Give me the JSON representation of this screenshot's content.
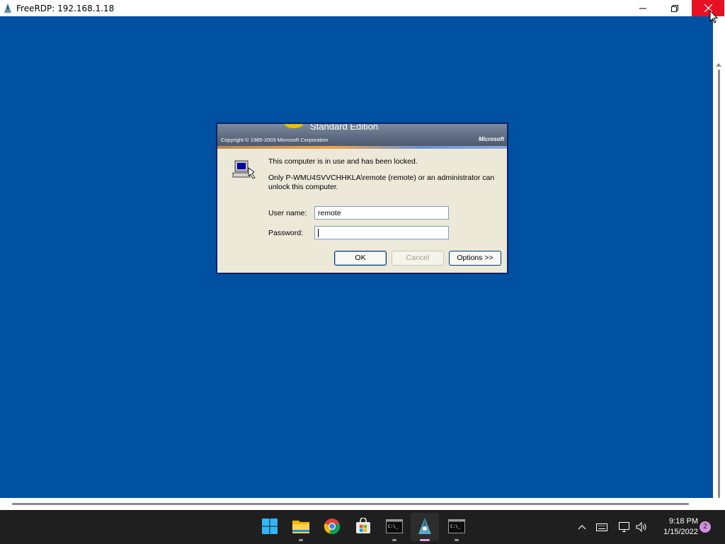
{
  "window": {
    "title": "FreeRDP: 192.168.1.18"
  },
  "dialog": {
    "edition": "Standard Edition",
    "copyright": "Copyright © 1985-2003  Microsoft Corporation",
    "brand": "Microsoft",
    "message_locked": "This computer is in use and has been locked.",
    "message_only": "Only P-WMU4SVVCHHKLA\\remote (remote) or an administrator can unlock this computer.",
    "username_label": "User name:",
    "username_value": "remote",
    "password_label": "Password:",
    "password_value": "",
    "ok_label": "OK",
    "cancel_label": "Cancel",
    "options_label": "Options >>"
  },
  "taskbar": {
    "time": "9:18 PM",
    "date": "1/15/2022",
    "notification_count": "2",
    "pinned": [
      "start-icon",
      "file-explorer-icon",
      "chrome-icon",
      "store-icon",
      "terminal-icon",
      "freerdp-icon",
      "terminal-icon"
    ]
  },
  "colors": {
    "desktop": "#0051a1",
    "close_button": "#e81123",
    "taskbar": "#1f1f1f",
    "dialog_bg": "#ece9d8"
  }
}
